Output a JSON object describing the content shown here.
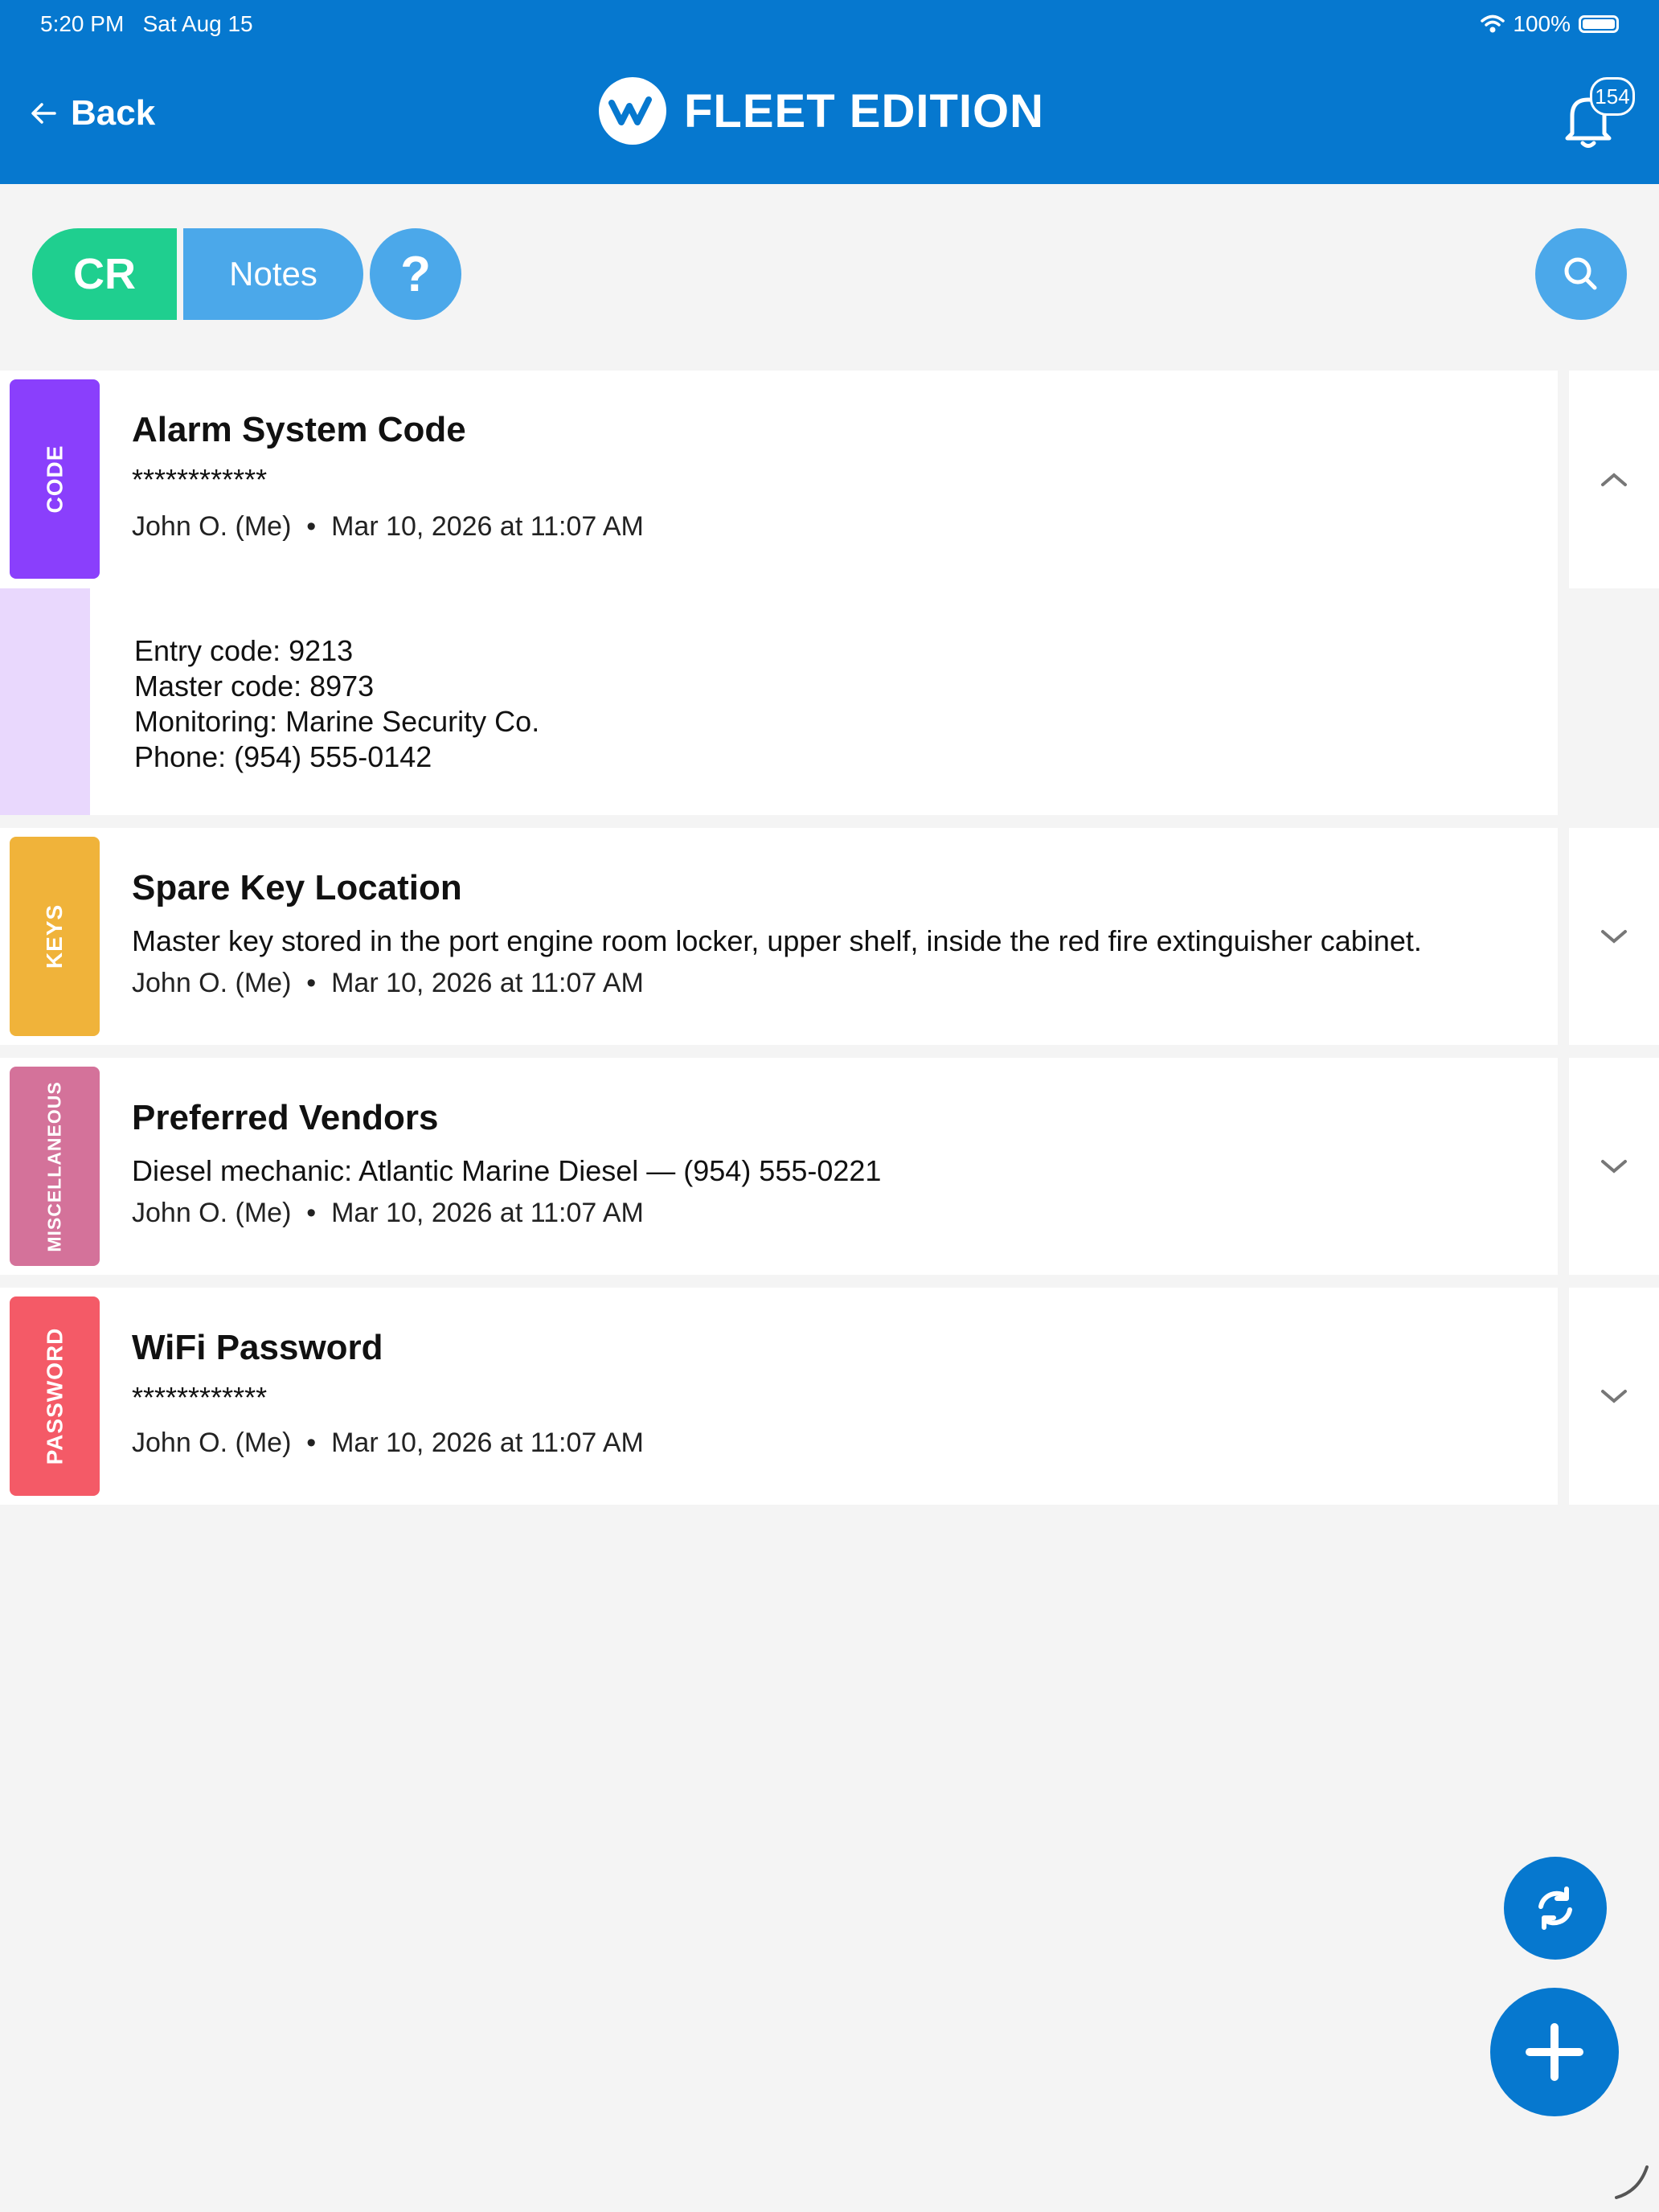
{
  "status_bar": {
    "time": "5:20 PM",
    "date": "Sat Aug 15",
    "battery": "100%"
  },
  "header": {
    "back_label": "Back",
    "brand": "FLEET EDITION",
    "notification_count": "154"
  },
  "toolbar": {
    "cr_label": "CR",
    "notes_label": "Notes",
    "help_label": "?"
  },
  "notes": [
    {
      "tag": "CODE",
      "tag_color": "#8a3ffc",
      "title": "Alarm System Code",
      "preview": "************",
      "author": "John O. (Me)",
      "date": "Mar 10, 2026 at 11:07 AM",
      "expanded": true,
      "details": [
        "Entry code: 9213",
        "Master code: 8973",
        "Monitoring: Marine Security Co.",
        "Phone: (954) 555-0142"
      ]
    },
    {
      "tag": "KEYS",
      "tag_color": "#f0b33a",
      "title": "Spare Key Location",
      "preview": "Master key stored in the port engine room locker, upper shelf, inside the red fire extinguisher cabinet.",
      "author": "John O. (Me)",
      "date": "Mar 10, 2026 at 11:07 AM",
      "expanded": false
    },
    {
      "tag": "MISCELLANEOUS",
      "tag_color": "#d4729a",
      "title": "Preferred Vendors",
      "preview": "Diesel mechanic: Atlantic Marine Diesel — (954) 555-0221",
      "author": "John O. (Me)",
      "date": "Mar 10, 2026 at 11:07 AM",
      "expanded": false
    },
    {
      "tag": "PASSWORD",
      "tag_color": "#f45a67",
      "title": "WiFi Password",
      "preview": "************",
      "author": "John O. (Me)",
      "date": "Mar 10, 2026 at 11:07 AM",
      "expanded": false
    }
  ],
  "separator": "•",
  "icons": {
    "back": "arrow-left-icon",
    "bell": "bell-icon",
    "search": "search-icon",
    "sync": "sync-icon",
    "add": "plus-icon",
    "chevron_up": "chevron-up-icon",
    "chevron_down": "chevron-down-icon"
  },
  "colors": {
    "primary": "#0678cf",
    "cr_green": "#1fcf8f",
    "light_blue": "#4ba8ea"
  }
}
